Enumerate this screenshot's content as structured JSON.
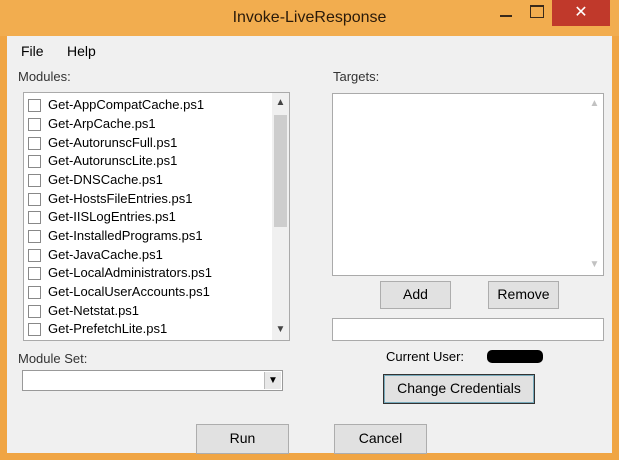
{
  "window": {
    "title": "Invoke-LiveResponse",
    "close_glyph": "✕"
  },
  "menu": [
    {
      "label": "File"
    },
    {
      "label": "Help"
    }
  ],
  "modules": {
    "label": "Modules:",
    "items": [
      {
        "label": "Get-AppCompatCache.ps1",
        "checked": false
      },
      {
        "label": "Get-ArpCache.ps1",
        "checked": false
      },
      {
        "label": "Get-AutorunscFull.ps1",
        "checked": false
      },
      {
        "label": "Get-AutorunscLite.ps1",
        "checked": false
      },
      {
        "label": "Get-DNSCache.ps1",
        "checked": false
      },
      {
        "label": "Get-HostsFileEntries.ps1",
        "checked": false
      },
      {
        "label": "Get-IISLogEntries.ps1",
        "checked": false
      },
      {
        "label": "Get-InstalledPrograms.ps1",
        "checked": false
      },
      {
        "label": "Get-JavaCache.ps1",
        "checked": false
      },
      {
        "label": "Get-LocalAdministrators.ps1",
        "checked": false
      },
      {
        "label": "Get-LocalUserAccounts.ps1",
        "checked": false
      },
      {
        "label": "Get-Netstat.ps1",
        "checked": false
      },
      {
        "label": "Get-PrefetchLite.ps1",
        "checked": false
      }
    ],
    "scroll_up_glyph": "▲",
    "scroll_down_glyph": "▼"
  },
  "targets": {
    "label": "Targets:",
    "items": [],
    "add_label": "Add",
    "remove_label": "Remove",
    "input_value": ""
  },
  "module_set": {
    "label": "Module Set:",
    "selected": "",
    "arrow_glyph": "▼"
  },
  "credentials": {
    "current_user_label": "Current User:",
    "change_label": "Change Credentials"
  },
  "actions": {
    "run_label": "Run",
    "cancel_label": "Cancel"
  }
}
